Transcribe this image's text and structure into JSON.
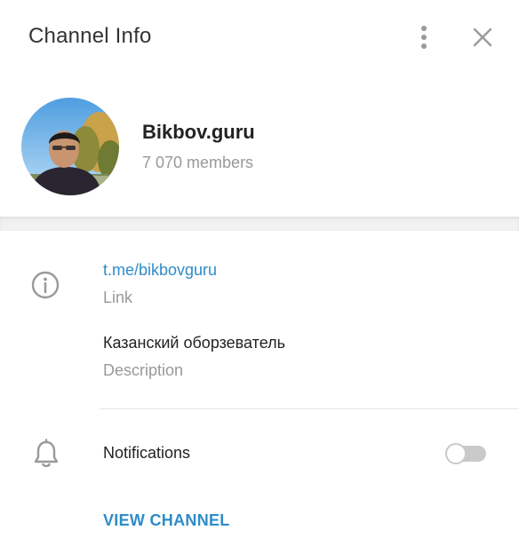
{
  "header": {
    "title": "Channel Info",
    "menu_icon": "more-vertical-icon",
    "close_icon": "close-icon"
  },
  "profile": {
    "name": "Bikbov.guru",
    "members": "7 070 members",
    "avatar_icon": "channel-avatar"
  },
  "info": {
    "icon": "info-icon",
    "link_value": "t.me/bikbovguru",
    "link_label": "Link",
    "description_value": "Казанский оборзеватель",
    "description_label": "Description"
  },
  "notifications": {
    "icon": "bell-icon",
    "label": "Notifications",
    "enabled": false
  },
  "actions": {
    "view_channel": "VIEW CHANNEL"
  },
  "colors": {
    "accent": "#2f8cc7",
    "secondary_text": "#999999",
    "icon": "#9a9a9a"
  }
}
